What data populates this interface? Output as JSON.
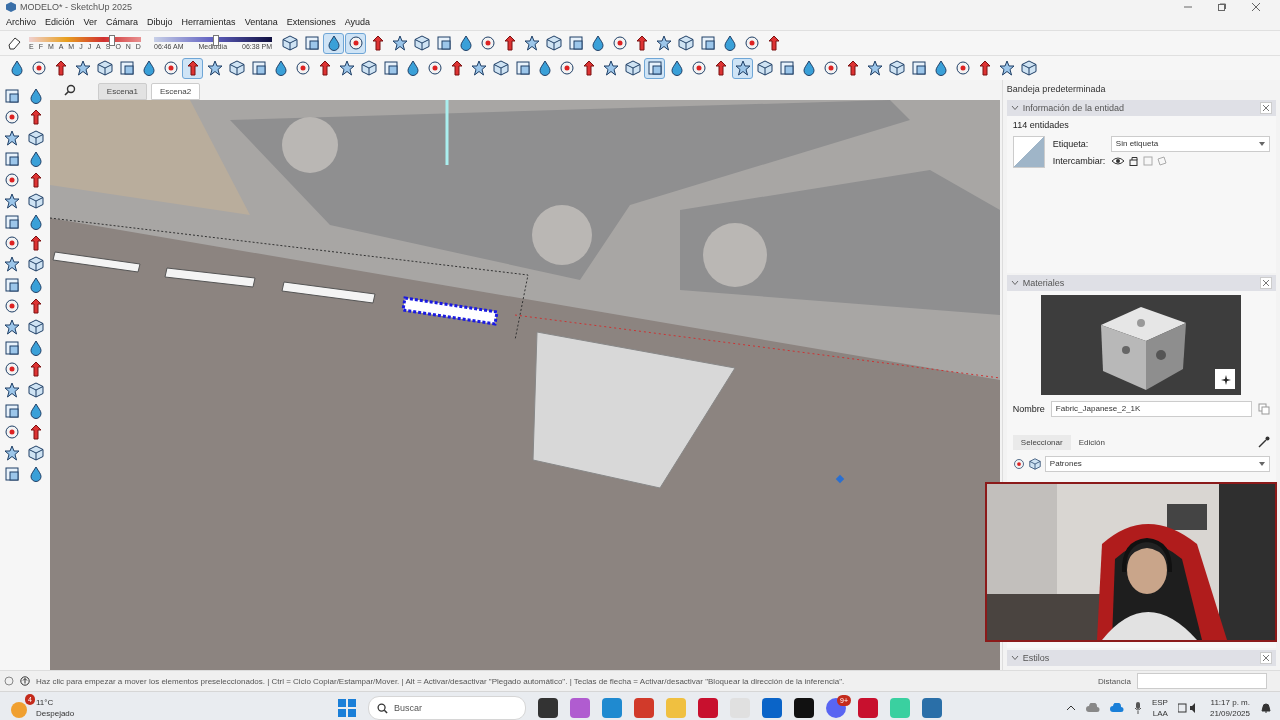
{
  "window": {
    "title": "MODELO* - SketchUp 2025"
  },
  "menu": [
    "Archivo",
    "Edición",
    "Ver",
    "Cámara",
    "Dibujo",
    "Herramientas",
    "Ventana",
    "Extensiones",
    "Ayuda"
  ],
  "shadow_settings": {
    "months": [
      "E",
      "F",
      "M",
      "A",
      "M",
      "J",
      "J",
      "A",
      "S",
      "O",
      "N",
      "D"
    ],
    "month_slider": {
      "level": 0.73
    },
    "time_start": "06:46 AM",
    "time_middle": "Mediodía",
    "time_end": "06:38 PM",
    "time_slider": {
      "level": 0.52
    }
  },
  "toolbar_row_1": [
    {
      "selected": false
    },
    {
      "selected": false
    },
    {
      "selected": true
    },
    {
      "selected": true
    },
    {
      "selected": false
    },
    {
      "selected": false
    },
    {
      "selected": false
    },
    {
      "selected": false
    },
    {
      "selected": false
    },
    {
      "selected": false
    },
    {
      "selected": false
    },
    {
      "selected": false
    },
    {
      "selected": false
    },
    {
      "selected": false
    },
    {
      "selected": false
    },
    {
      "selected": false
    },
    {
      "selected": false
    },
    {
      "selected": false
    },
    {
      "selected": false
    },
    {
      "selected": false
    },
    {
      "selected": false
    },
    {
      "selected": false
    },
    {
      "selected": false
    }
  ],
  "toolbar_row_2": [
    {
      "selected": false
    },
    {
      "selected": false
    },
    {
      "selected": false
    },
    {
      "selected": false
    },
    {
      "selected": false
    },
    {
      "selected": false
    },
    {
      "selected": false
    },
    {
      "selected": false
    },
    {
      "selected": true
    },
    {
      "selected": false
    },
    {
      "selected": false
    },
    {
      "selected": false
    },
    {
      "selected": false
    },
    {
      "selected": false
    },
    {
      "selected": false
    },
    {
      "selected": false
    },
    {
      "selected": false
    },
    {
      "selected": false
    },
    {
      "selected": false
    },
    {
      "selected": false
    },
    {
      "selected": false
    },
    {
      "selected": false
    },
    {
      "selected": false
    },
    {
      "selected": false
    },
    {
      "selected": false
    },
    {
      "selected": false
    },
    {
      "selected": false
    },
    {
      "selected": false
    },
    {
      "selected": false
    },
    {
      "selected": true
    },
    {
      "selected": false
    },
    {
      "selected": false
    },
    {
      "selected": false
    },
    {
      "selected": true
    },
    {
      "selected": false
    },
    {
      "selected": false
    },
    {
      "selected": false
    },
    {
      "selected": false
    },
    {
      "selected": false
    },
    {
      "selected": false
    },
    {
      "selected": false
    },
    {
      "selected": false
    },
    {
      "selected": false
    },
    {
      "selected": false
    },
    {
      "selected": false
    },
    {
      "selected": false
    },
    {
      "selected": false
    }
  ],
  "left_toolbar": [
    {
      "selected": false
    },
    {
      "selected": false
    },
    {
      "selected": false
    },
    {
      "selected": false
    },
    {
      "selected": false
    },
    {
      "selected": false
    },
    {
      "selected": false
    },
    {
      "selected": false
    },
    {
      "selected": false
    },
    {
      "selected": false
    },
    {
      "selected": false
    },
    {
      "selected": false
    },
    {
      "selected": false
    },
    {
      "selected": false
    },
    {
      "selected": false
    },
    {
      "selected": false
    },
    {
      "selected": false
    },
    {
      "selected": false
    },
    {
      "selected": false
    },
    {
      "selected": false
    },
    {
      "selected": false
    },
    {
      "selected": false
    },
    {
      "selected": false
    },
    {
      "selected": false
    },
    {
      "selected": false
    },
    {
      "selected": false
    },
    {
      "selected": false
    },
    {
      "selected": false
    },
    {
      "selected": false
    },
    {
      "selected": false
    },
    {
      "selected": false
    },
    {
      "selected": false
    },
    {
      "selected": false
    },
    {
      "selected": false
    },
    {
      "selected": false
    },
    {
      "selected": false
    },
    {
      "selected": false
    },
    {
      "selected": false
    }
  ],
  "scene_tabs": [
    {
      "label": "Escena1",
      "selected": false
    },
    {
      "label": "Escena2",
      "selected": true
    }
  ],
  "tray": {
    "title": "Bandeja predeterminada",
    "entity_info": {
      "title": "Información de la entidad",
      "count": "114 entidades",
      "tag_label": "Etiqueta:",
      "tag_value": "Sin etiqueta",
      "toggle_label": "Intercambiar:"
    },
    "materials": {
      "title": "Materiales",
      "name_label": "Nombre",
      "name_value": "Fabric_Japanese_2_1K",
      "tabs": [
        {
          "label": "Seleccionar",
          "selected": true
        },
        {
          "label": "Edición",
          "selected": false
        }
      ],
      "library": "Patrones"
    },
    "styles": {
      "title": "Estilos"
    }
  },
  "status_bar": {
    "message": "Haz clic para empezar a mover los elementos preseleccionados. | Ctrl = Ciclo Copiar/Estampar/Mover. | Alt = Activar/desactivar \"Plegado automático\". | Teclas de flecha = Activar/desactivar \"Bloquear la dirección de la inferencia\".",
    "measure_label": "Distancia"
  },
  "taskbar": {
    "weather_badge": "4",
    "temperature": "11°C",
    "weather": "Despejado",
    "search_placeholder": "Buscar",
    "chat_badge": "9+",
    "language": "ESP",
    "layout": "LAA",
    "time": "11:17 p. m.",
    "date": "21/09/2025"
  }
}
